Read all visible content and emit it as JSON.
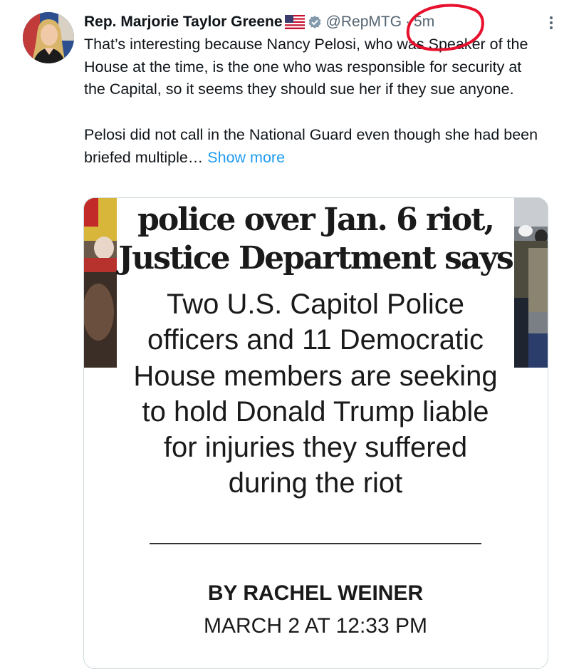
{
  "tweet": {
    "author_name": "Rep. Marjorie Taylor Greene",
    "flag_emoji": "US flag",
    "handle": "@RepMTG",
    "separator": "·",
    "time_ago": "5m",
    "text_paragraph_1": "That’s interesting because Nancy Pelosi, who was Speaker of the House at the time, is the one who was responsible for security at the Capital, so it seems they should sue her if they sue anyone.",
    "text_paragraph_2": "Pelosi did not call in the National Guard even though she had been briefed multiple… ",
    "show_more_label": "Show more"
  },
  "attachment": {
    "headline_line_1": "police over Jan. 6 riot,",
    "headline_line_2": "Justice Department says",
    "subheadline": "Two U.S. Capitol Police officers and 11 Democratic House members are seeking to hold Donald Trump liable for injuries they suffered during the riot",
    "byline": "BY RACHEL WEINER",
    "dateline": "MARCH 2 AT 12:33 PM"
  },
  "annotation": {
    "circle_color": "#e8112d"
  },
  "colors": {
    "link": "#1d9bf0",
    "secondary_text": "#536471",
    "primary_text": "#0f1419"
  }
}
